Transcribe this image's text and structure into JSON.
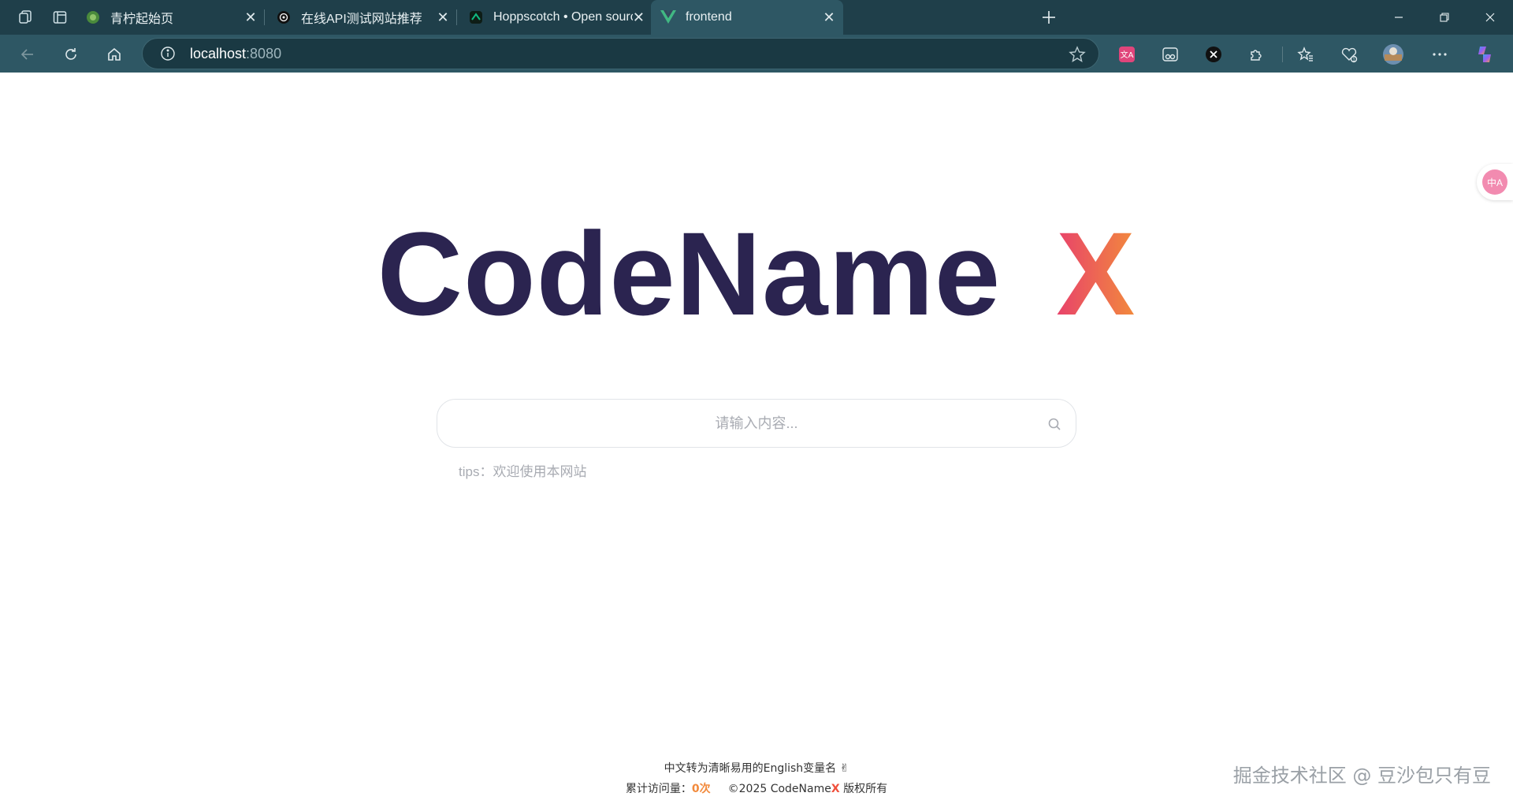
{
  "browser": {
    "tabs": [
      {
        "title": "青柠起始页",
        "favicon": "green-circle-icon"
      },
      {
        "title": "在线API测试网站推荐",
        "favicon": "openai-icon"
      },
      {
        "title": "Hoppscotch • Open source API development ecosystem",
        "favicon": "hoppscotch-icon"
      },
      {
        "title": "frontend",
        "favicon": "vue-icon"
      }
    ],
    "address": {
      "host": "localhost",
      "port": ":8080"
    }
  },
  "page": {
    "logo": {
      "main": "CodeName",
      "accent": "X"
    },
    "search": {
      "placeholder": "请输入内容..."
    },
    "tips": "tips：欢迎使用本网站",
    "footer": {
      "line1": "中文转为清晰易用的English变量名 ✌",
      "visits_label": "累计访问量：",
      "visits_count": "0次",
      "copyright_prefix": "©2025 CodeName",
      "copyright_x": "X",
      "copyright_suffix": " 版权所有"
    },
    "watermark": "掘金技术社区 @ 豆沙包只有豆",
    "translate_badge": "中A"
  },
  "colors": {
    "logo_text": "#2b2450",
    "logo_x_start": "#e8426b",
    "logo_x_end": "#f28a3c",
    "chrome_dark": "#1f3f4a",
    "chrome_toolbar": "#2e5764"
  }
}
